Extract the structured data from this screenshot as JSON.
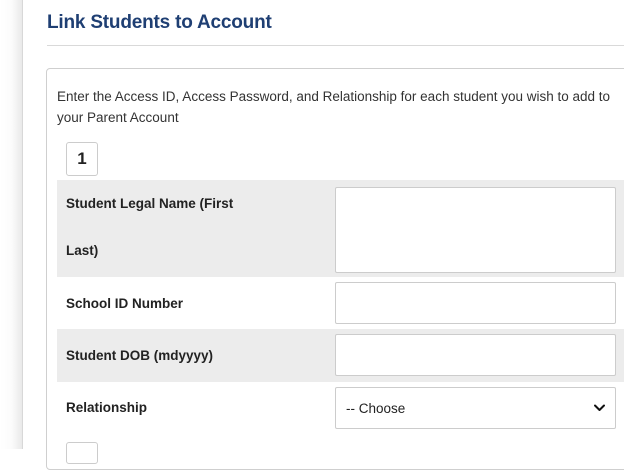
{
  "page": {
    "title": "Link Students to Account",
    "instructions": "Enter the Access ID, Access Password, and Relationship for each student you wish to add to your Parent Account"
  },
  "student_block": {
    "number": "1",
    "fields": {
      "legal_name": {
        "label": "Student Legal Name (First Last)",
        "value": ""
      },
      "school_id": {
        "label": "School ID Number",
        "value": ""
      },
      "dob": {
        "label": "Student DOB (mdyyyy)",
        "value": ""
      },
      "relationship": {
        "label": "Relationship",
        "selected": "-- Choose"
      }
    }
  },
  "icons": {
    "select_chevron": "chevron-down-icon"
  }
}
